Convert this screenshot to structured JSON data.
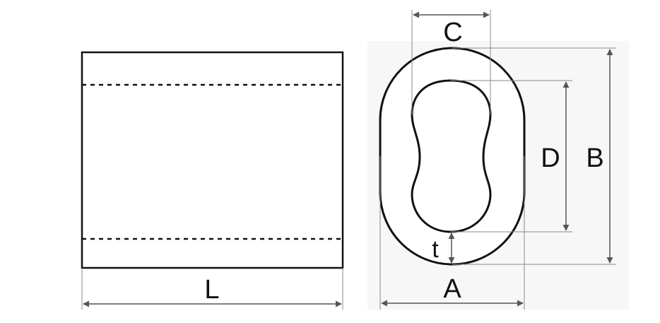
{
  "diagram": {
    "labels": {
      "length": "L",
      "outer_width": "A",
      "outer_height": "B",
      "inner_width": "C",
      "inner_height": "D",
      "wall_thickness": "t"
    },
    "colors": {
      "outline": "#111111",
      "dimension_line": "#555555",
      "extension_line": "#8a8a8a",
      "background_panel": "#f6f6f6"
    }
  }
}
